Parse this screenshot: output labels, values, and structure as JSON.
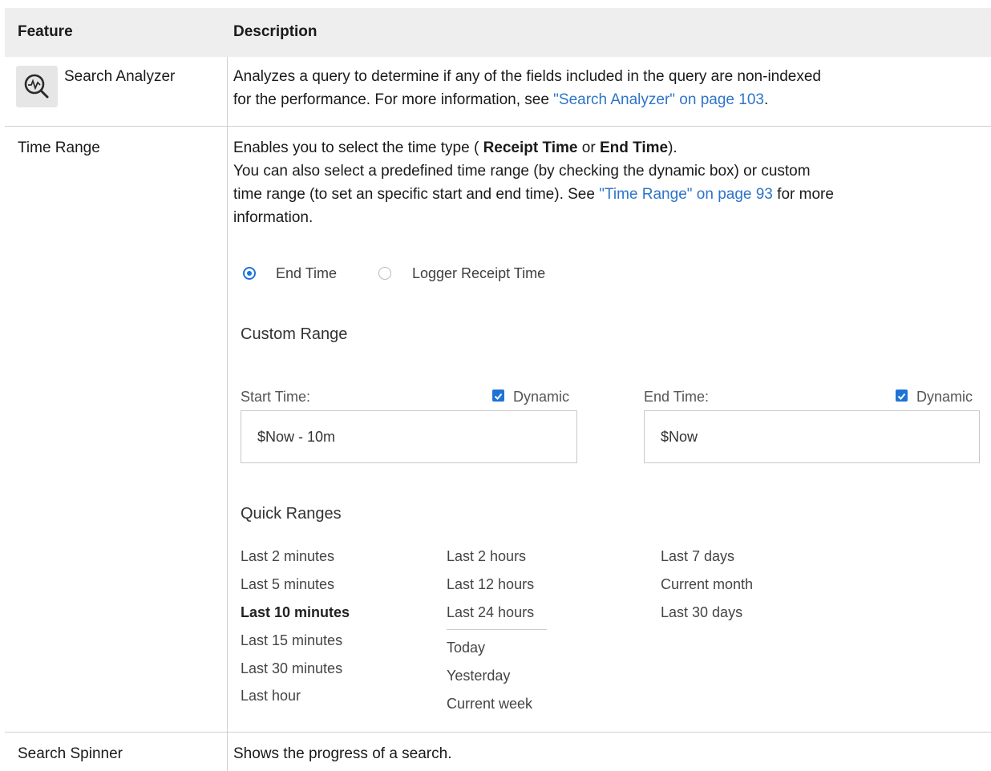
{
  "table": {
    "headers": {
      "feature": "Feature",
      "description": "Description"
    },
    "rows": {
      "search_analyzer": {
        "feature": "Search Analyzer",
        "icon": "search-analyzer-icon",
        "desc_pre": "Analyzes a query to determine if any of the fields included in the query are non-indexed",
        "desc_line2_pre": "for the performance. For more information, see ",
        "desc_link": "\"Search Analyzer\" on page 103",
        "desc_post": "."
      },
      "time_range": {
        "feature": "Time Range",
        "line1_pre": "Enables you to select the time type ( ",
        "line1_bold1": "Receipt Time",
        "line1_mid": " or ",
        "line1_bold2": "End Time",
        "line1_post": ").",
        "line2": "You can also select a predefined time range (by checking the dynamic box) or custom",
        "line3_pre": "time range (to set an specific start and end time). See ",
        "line3_link": "\"Time Range\" on page 93",
        "line3_post": " for more",
        "line4": "information."
      },
      "search_spinner": {
        "feature": "Search Spinner",
        "description": "Shows the progress of a search."
      }
    }
  },
  "time_widget": {
    "radio_end_time": "End Time",
    "radio_receipt_time": "Logger Receipt Time",
    "selected_radio": "End Time",
    "custom_range_title": "Custom Range",
    "start_label": "Start Time:",
    "start_dynamic_label": "Dynamic",
    "start_dynamic_checked": true,
    "start_value": "$Now - 10m",
    "end_label": "End Time:",
    "end_dynamic_label": "Dynamic",
    "end_dynamic_checked": true,
    "end_value": "$Now",
    "quick_ranges_title": "Quick Ranges",
    "quick_col1": [
      "Last 2 minutes",
      "Last 5 minutes",
      "Last 10 minutes",
      "Last 15 minutes",
      "Last 30 minutes",
      "Last hour"
    ],
    "quick_col2a": [
      "Last 2 hours",
      "Last 12 hours",
      "Last 24 hours"
    ],
    "quick_col2b": [
      "Today",
      "Yesterday",
      "Current week"
    ],
    "quick_col3": [
      "Last 7 days",
      "Current month",
      "Last 30 days"
    ],
    "selected_quick": "Last 10 minutes"
  },
  "colors": {
    "link": "#2e74c9",
    "accent": "#1f73d6",
    "header_bg": "#eeeeee"
  }
}
